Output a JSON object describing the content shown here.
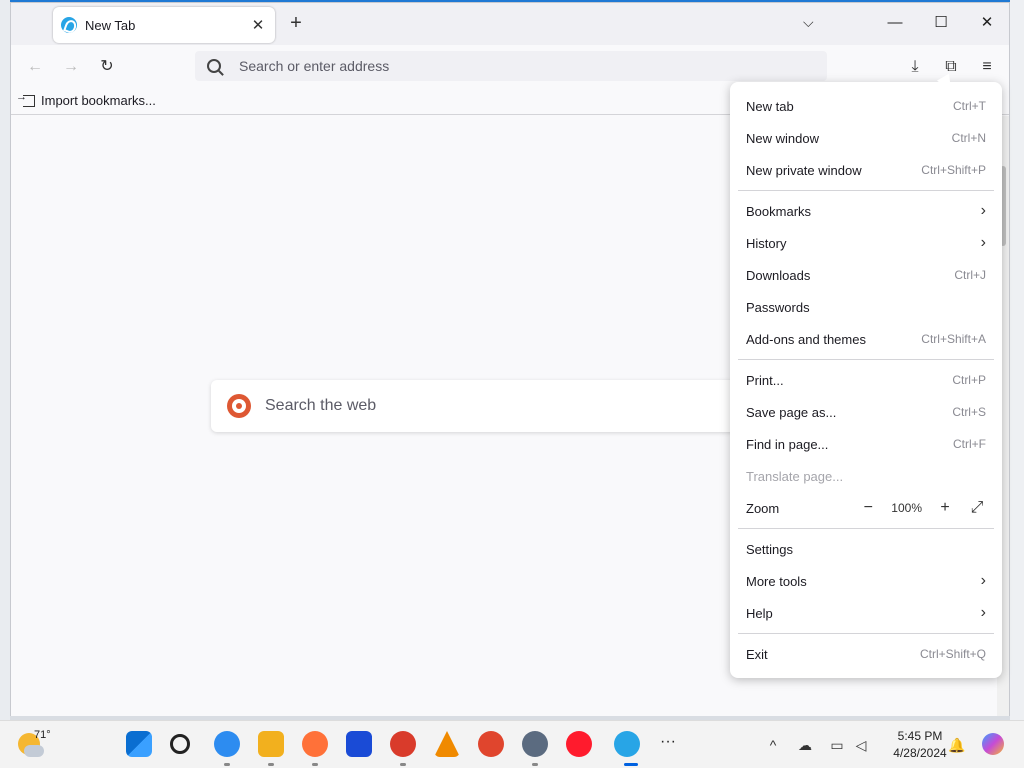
{
  "tab": {
    "title": "New Tab",
    "close": "✕"
  },
  "tab_strip": {
    "new_tab": "+",
    "list_all_tabs": "⌵"
  },
  "window_controls": {
    "minimize": "—",
    "maximize": "☐",
    "close": "✕"
  },
  "nav": {
    "back": "←",
    "forward": "→",
    "reload": "↻"
  },
  "urlbar": {
    "placeholder": "Search or enter address"
  },
  "toolbar": {
    "downloads": "⤓",
    "extensions": "⧉",
    "menu": "≡"
  },
  "bookmarks_bar": {
    "import": "Import bookmarks..."
  },
  "content": {
    "search_placeholder": "Search the web"
  },
  "menu": {
    "new_tab": {
      "label": "New tab",
      "shortcut": "Ctrl+T"
    },
    "new_window": {
      "label": "New window",
      "shortcut": "Ctrl+N"
    },
    "new_private_window": {
      "label": "New private window",
      "shortcut": "Ctrl+Shift+P"
    },
    "bookmarks": {
      "label": "Bookmarks"
    },
    "history": {
      "label": "History"
    },
    "downloads": {
      "label": "Downloads",
      "shortcut": "Ctrl+J"
    },
    "passwords": {
      "label": "Passwords"
    },
    "addons": {
      "label": "Add-ons and themes",
      "shortcut": "Ctrl+Shift+A"
    },
    "print": {
      "label": "Print...",
      "shortcut": "Ctrl+P"
    },
    "save_page": {
      "label": "Save page as...",
      "shortcut": "Ctrl+S"
    },
    "find": {
      "label": "Find in page...",
      "shortcut": "Ctrl+F"
    },
    "translate": {
      "label": "Translate page..."
    },
    "zoom": {
      "label": "Zoom",
      "minus": "−",
      "value": "100%",
      "plus": "+",
      "fullscreen": "⤢"
    },
    "settings": {
      "label": "Settings"
    },
    "more_tools": {
      "label": "More tools"
    },
    "help": {
      "label": "Help"
    },
    "exit": {
      "label": "Exit",
      "shortcut": "Ctrl+Shift+Q"
    },
    "submenu_chevron": "›"
  },
  "taskbar": {
    "weather_temp": "71°",
    "time": "5:45 PM",
    "date": "4/28/2024",
    "overflow": "···",
    "tray_chevron": "^"
  },
  "colors": {
    "accent": "#0061e0",
    "taskbar": "#f3f3f3",
    "menu_bg": "#ffffff"
  }
}
